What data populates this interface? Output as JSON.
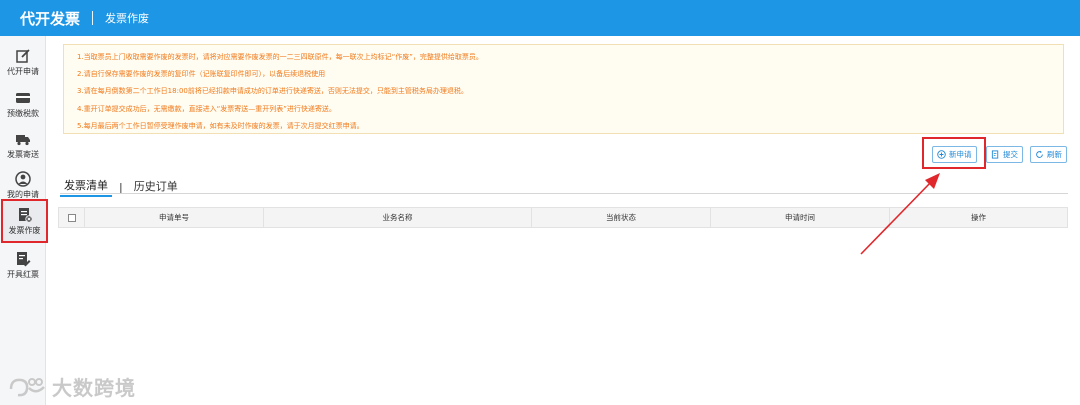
{
  "header": {
    "title": "代开发票",
    "subtitle": "发票作废"
  },
  "sidebar": {
    "items": [
      {
        "label": "代开申请",
        "icon": "edit-icon"
      },
      {
        "label": "预缴税款",
        "icon": "card-icon"
      },
      {
        "label": "发票寄送",
        "icon": "truck-icon"
      },
      {
        "label": "我的申请",
        "icon": "user-icon"
      },
      {
        "label": "发票作废",
        "icon": "invoice-void-icon",
        "active": true
      },
      {
        "label": "开具红票",
        "icon": "red-invoice-icon"
      }
    ]
  },
  "notice": {
    "lines": [
      "1.当取票员上门收取需要作废的发票时，请将对应需要作废发票的一二三四联原件，每一联次上均标记“作废”，完整提供给取票员。",
      "2.请自行保存需要作废的发票的复印件（记账联复印件即可），以备后续退税使用",
      "3.请在每月倒数第二个工作日18:00前将已经扣款申请成功的订单进行快递寄送，否则无法提交，只能到主管税务局办理退税。",
      "4.重开订单提交成功后，无需缴款，直接进入“发票寄送—重开列表”进行快递寄送。",
      "5.每月最后两个工作日暂停受理作废申请，如有未及时作废的发票，请于次月提交红票申请。"
    ]
  },
  "toolbar": {
    "new_label": "新申请",
    "submit_label": "提交",
    "refresh_label": "刷新"
  },
  "tabs": [
    {
      "label": "发票清单",
      "active": true
    },
    {
      "label": "历史订单",
      "active": false
    }
  ],
  "table": {
    "columns": [
      "申请单号",
      "业务名称",
      "当前状态",
      "申请时间",
      "操作"
    ]
  },
  "watermark": {
    "text": "大数跨境"
  },
  "colors": {
    "topbar": "#1e96e6",
    "notice_text": "#f07a1a",
    "highlight": "#e0282c"
  }
}
